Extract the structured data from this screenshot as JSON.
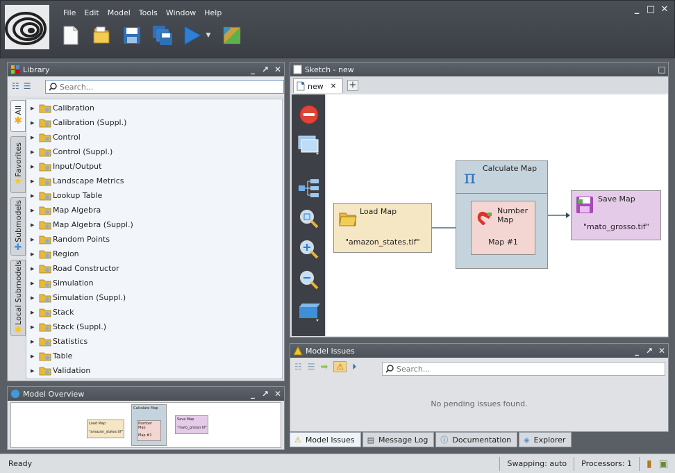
{
  "menu": [
    "File",
    "Edit",
    "Model",
    "Tools",
    "Window",
    "Help"
  ],
  "window_controls": [
    "minimize-icon",
    "maximize-icon",
    "close-icon"
  ],
  "toolbar": [
    "new-file-icon",
    "open-folder-icon",
    "save-icon",
    "save-all-icon",
    "run-icon",
    "run-dropdown-icon",
    "map-viewer-icon"
  ],
  "library": {
    "title": "Library",
    "search_placeholder": "Search...",
    "tabs": [
      "All",
      "Favorites",
      "Submodels",
      "Local Submodels"
    ],
    "items": [
      "Calibration",
      "Calibration (Suppl.)",
      "Control",
      "Control (Suppl.)",
      "Input/Output",
      "Landscape Metrics",
      "Lookup Table",
      "Map Algebra",
      "Map Algebra (Suppl.)",
      "Random Points",
      "Region",
      "Road Constructor",
      "Simulation",
      "Simulation (Suppl.)",
      "Stack",
      "Stack (Suppl.)",
      "Statistics",
      "Table",
      "Validation"
    ]
  },
  "overview": {
    "title": "Model Overview",
    "load": "Load Map",
    "load_value": "\"amazon_states.tif\"",
    "calc": "Calculate Map",
    "number": "Number Map",
    "map1": "Map #1",
    "save": "Save Map",
    "save_value": "\"mato_grosso.tif\""
  },
  "sketch": {
    "title": "Sketch - new",
    "tab": "new",
    "nodes": {
      "load_title": "Load Map",
      "load_value": "\"amazon_states.tif\"",
      "calc_title": "Calculate Map",
      "number_title": "Number Map",
      "number_value": "Map #1",
      "save_title": "Save Map",
      "save_value": "\"mato_grosso.tif\""
    }
  },
  "issues": {
    "title": "Model Issues",
    "search_placeholder": "Search...",
    "empty": "No pending issues found."
  },
  "bottom_tabs": [
    "Model Issues",
    "Message Log",
    "Documentation",
    "Explorer"
  ],
  "status": {
    "text": "Ready",
    "swapping": "Swapping: auto",
    "processors": "Processors: 1"
  },
  "colors": {
    "load_node": "#f6e7c4",
    "calc_node": "#c5d3dc",
    "number_node": "#f3d6d2",
    "save_node": "#e4cbe8"
  }
}
